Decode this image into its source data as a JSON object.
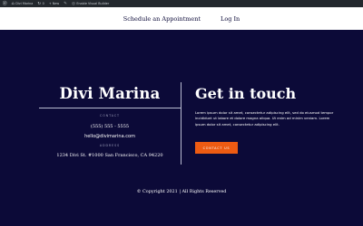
{
  "admin_bar": {
    "items": [
      {
        "icon": "wordpress-icon",
        "label": ""
      },
      {
        "icon": "home-icon",
        "label": "Divi Marina"
      },
      {
        "icon": "refresh-icon",
        "label": "0"
      },
      {
        "icon": "plus-icon",
        "label": "+ New"
      },
      {
        "icon": "edit-icon",
        "label": ""
      },
      {
        "icon": "divi-icon",
        "label": "Enable Visual Builder"
      }
    ]
  },
  "nav": {
    "links": [
      "Schedule an Appointment",
      "Log In"
    ]
  },
  "brand": {
    "name": "Divi Marina",
    "contact_label": "CONTACT",
    "phone": "(555) 555 - 5555",
    "email": "hello@divimarina.com",
    "address_label": "ADDRESS",
    "address": "1234 Divi St. #1000 San Francisco, CA 94220"
  },
  "touch": {
    "title": "Get in touch",
    "body": "Lorem ipsum dolor sit amet, consectetur adipiscing elit, sed do eiusmod tempor incididunt ut labore et dolore magna aliqua. Ut enim ad minim veniam. Lorem ipsum dolor sit amet, consectetur adipiscing elit.",
    "button": "CONTACT US"
  },
  "footer": {
    "copyright": "© Copyright 2021 | All Rights Reserved"
  },
  "colors": {
    "background": "#0c0a38",
    "accent": "#ee5b12",
    "nav_bg": "#ffffff",
    "admin_bg": "#23282d"
  }
}
